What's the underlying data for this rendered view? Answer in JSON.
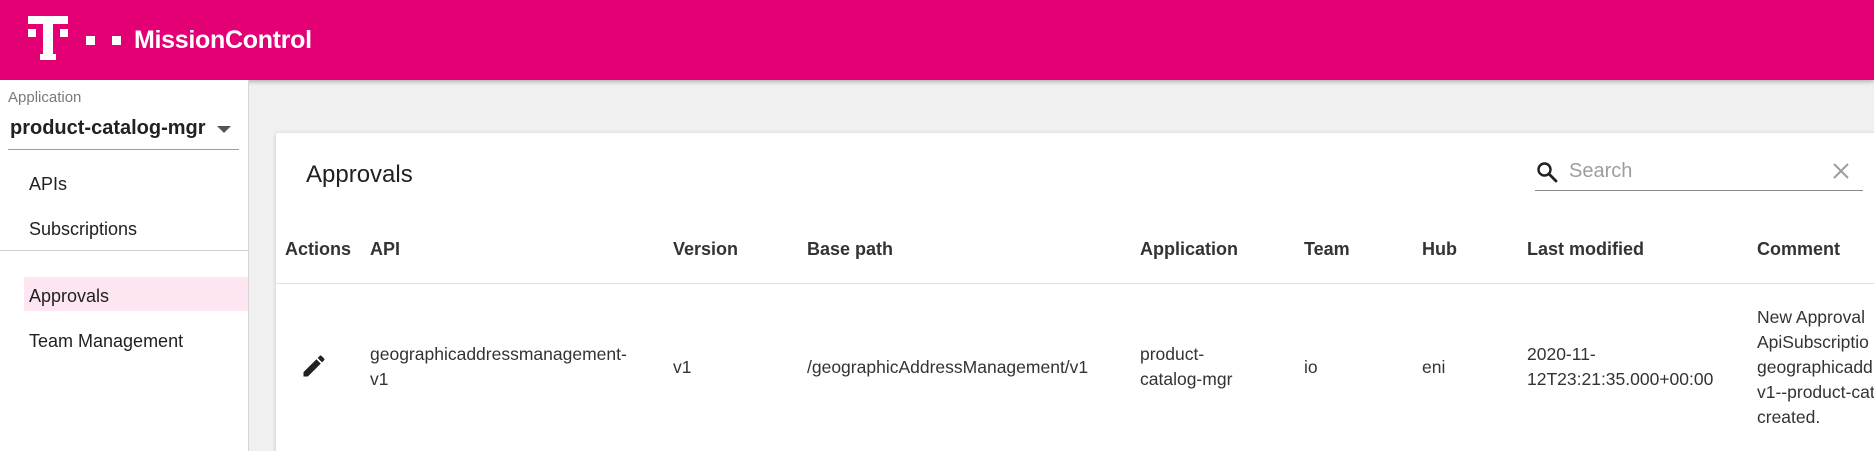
{
  "header": {
    "title": "MissionControl",
    "logo_letter": "T",
    "brand_color": "#e20074"
  },
  "sidebar": {
    "application_label": "Application",
    "application_value": "product-catalog-mgr",
    "items": [
      {
        "label": "APIs"
      },
      {
        "label": "Subscriptions"
      },
      {
        "label": "Approvals",
        "active": true
      },
      {
        "label": "Team Management"
      }
    ]
  },
  "main": {
    "title": "Approvals",
    "search": {
      "placeholder": "Search",
      "value": ""
    },
    "table": {
      "columns": [
        "Actions",
        "API",
        "Version",
        "Base path",
        "Application",
        "Team",
        "Hub",
        "Last modified",
        "Comment"
      ],
      "rows": [
        {
          "action_icon": "edit-icon",
          "api": "geographicaddressmanagement-\nv1",
          "version": "v1",
          "base_path": "/geographicAddressManagement/v1",
          "application": "product-\ncatalog-mgr",
          "team": "io",
          "hub": "eni",
          "last_modified": "2020-11-\n12T23:21:35.000+00:00",
          "comment": "New Approval\nApiSubscriptio\ngeographicadd\nv1--product-cat\ncreated."
        }
      ]
    }
  }
}
